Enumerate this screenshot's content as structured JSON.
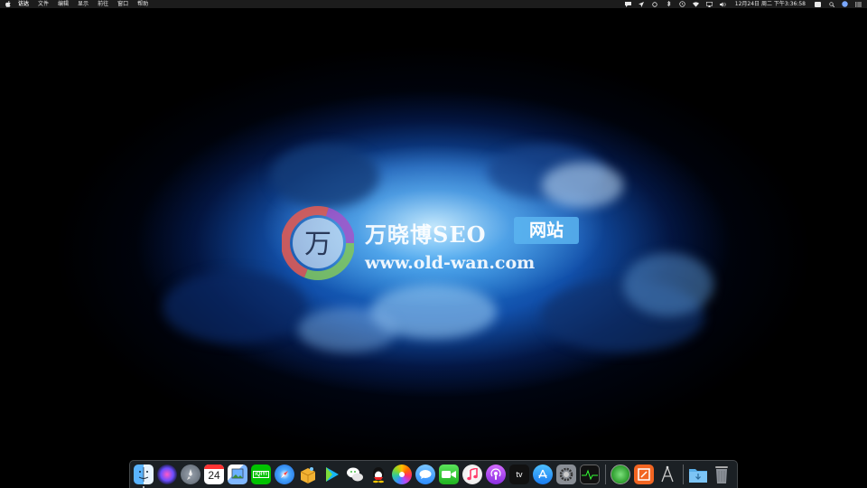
{
  "menubar": {
    "app_name": "访达",
    "menus": [
      "文件",
      "编辑",
      "显示",
      "前往",
      "窗口",
      "帮助"
    ],
    "status_icons": [
      "chat-bubble-icon",
      "location-arrow-icon",
      "circle-arrow-icon",
      "bluetooth-icon",
      "time-machine-icon",
      "wifi-icon",
      "airplay-icon",
      "volume-icon"
    ],
    "clock": "12月24日 周二 下午3:36:58",
    "right_icons": [
      "keyboard-input-icon",
      "search-icon",
      "siri-icon",
      "notification-center-icon"
    ]
  },
  "watermark": {
    "logo_glyph": "万",
    "title": "万晓博SEO",
    "badge": "网站",
    "url": "www.old-wan.com"
  },
  "dock": {
    "calendar_day": "24",
    "iqiyi_label": "iQIYI",
    "appletv_label": "tv",
    "apps": [
      {
        "name": "finder",
        "running": true
      },
      {
        "name": "siri"
      },
      {
        "name": "launchpad"
      },
      {
        "name": "calendar"
      },
      {
        "name": "preview"
      },
      {
        "name": "iqiyi"
      },
      {
        "name": "safari"
      },
      {
        "name": "sandbox-box"
      },
      {
        "name": "media-player"
      },
      {
        "name": "wechat"
      },
      {
        "name": "qq"
      },
      {
        "name": "photos"
      },
      {
        "name": "messages"
      },
      {
        "name": "facetime"
      },
      {
        "name": "music"
      },
      {
        "name": "podcasts"
      },
      {
        "name": "apple-tv"
      },
      {
        "name": "app-store"
      },
      {
        "name": "system-preferences"
      },
      {
        "name": "activity-monitor"
      },
      {
        "name": "green-circle-app"
      },
      {
        "name": "red-square-app"
      },
      {
        "name": "wireless-diagnostics"
      },
      {
        "name": "downloads-folder"
      },
      {
        "name": "trash"
      }
    ]
  }
}
